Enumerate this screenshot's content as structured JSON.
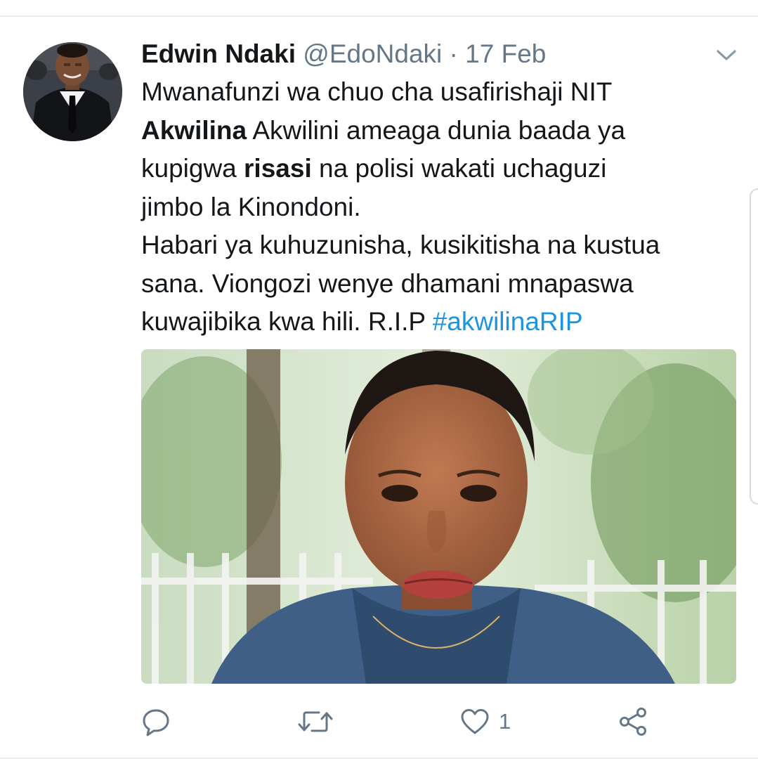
{
  "tweet": {
    "author": {
      "display_name": "Edwin Ndaki",
      "handle": "@EdoNdaki",
      "separator": "·",
      "timestamp": "17 Feb"
    },
    "text": {
      "line1": "Mwanafunzi wa chuo cha usafirishaji NIT",
      "line2_bold": "Akwilina",
      "line2_rest": " Akwilini ameaga dunia baada ya",
      "line3_start": "kupigwa ",
      "line3_bold": "risasi",
      "line3_rest": " na polisi wakati uchaguzi",
      "line4": "jimbo la Kinondoni.",
      "line5": "Habari ya kuhuzunisha, kusikitisha na kustua",
      "line6": "sana. Viongozi wenye dhamani mnapaswa",
      "line7_text": "kuwajibika kwa hili. R.I.P ",
      "hashtag": "#akwilinaRIP"
    },
    "actions": {
      "reply_icon": "reply-icon",
      "retweet_icon": "retweet-icon",
      "like_icon": "heart-icon",
      "like_count": "1",
      "share_icon": "share-icon"
    }
  },
  "colors": {
    "primary_text": "#14171a",
    "secondary_text": "#657786",
    "link": "#1b95e0",
    "divider": "#e6ecf0"
  }
}
